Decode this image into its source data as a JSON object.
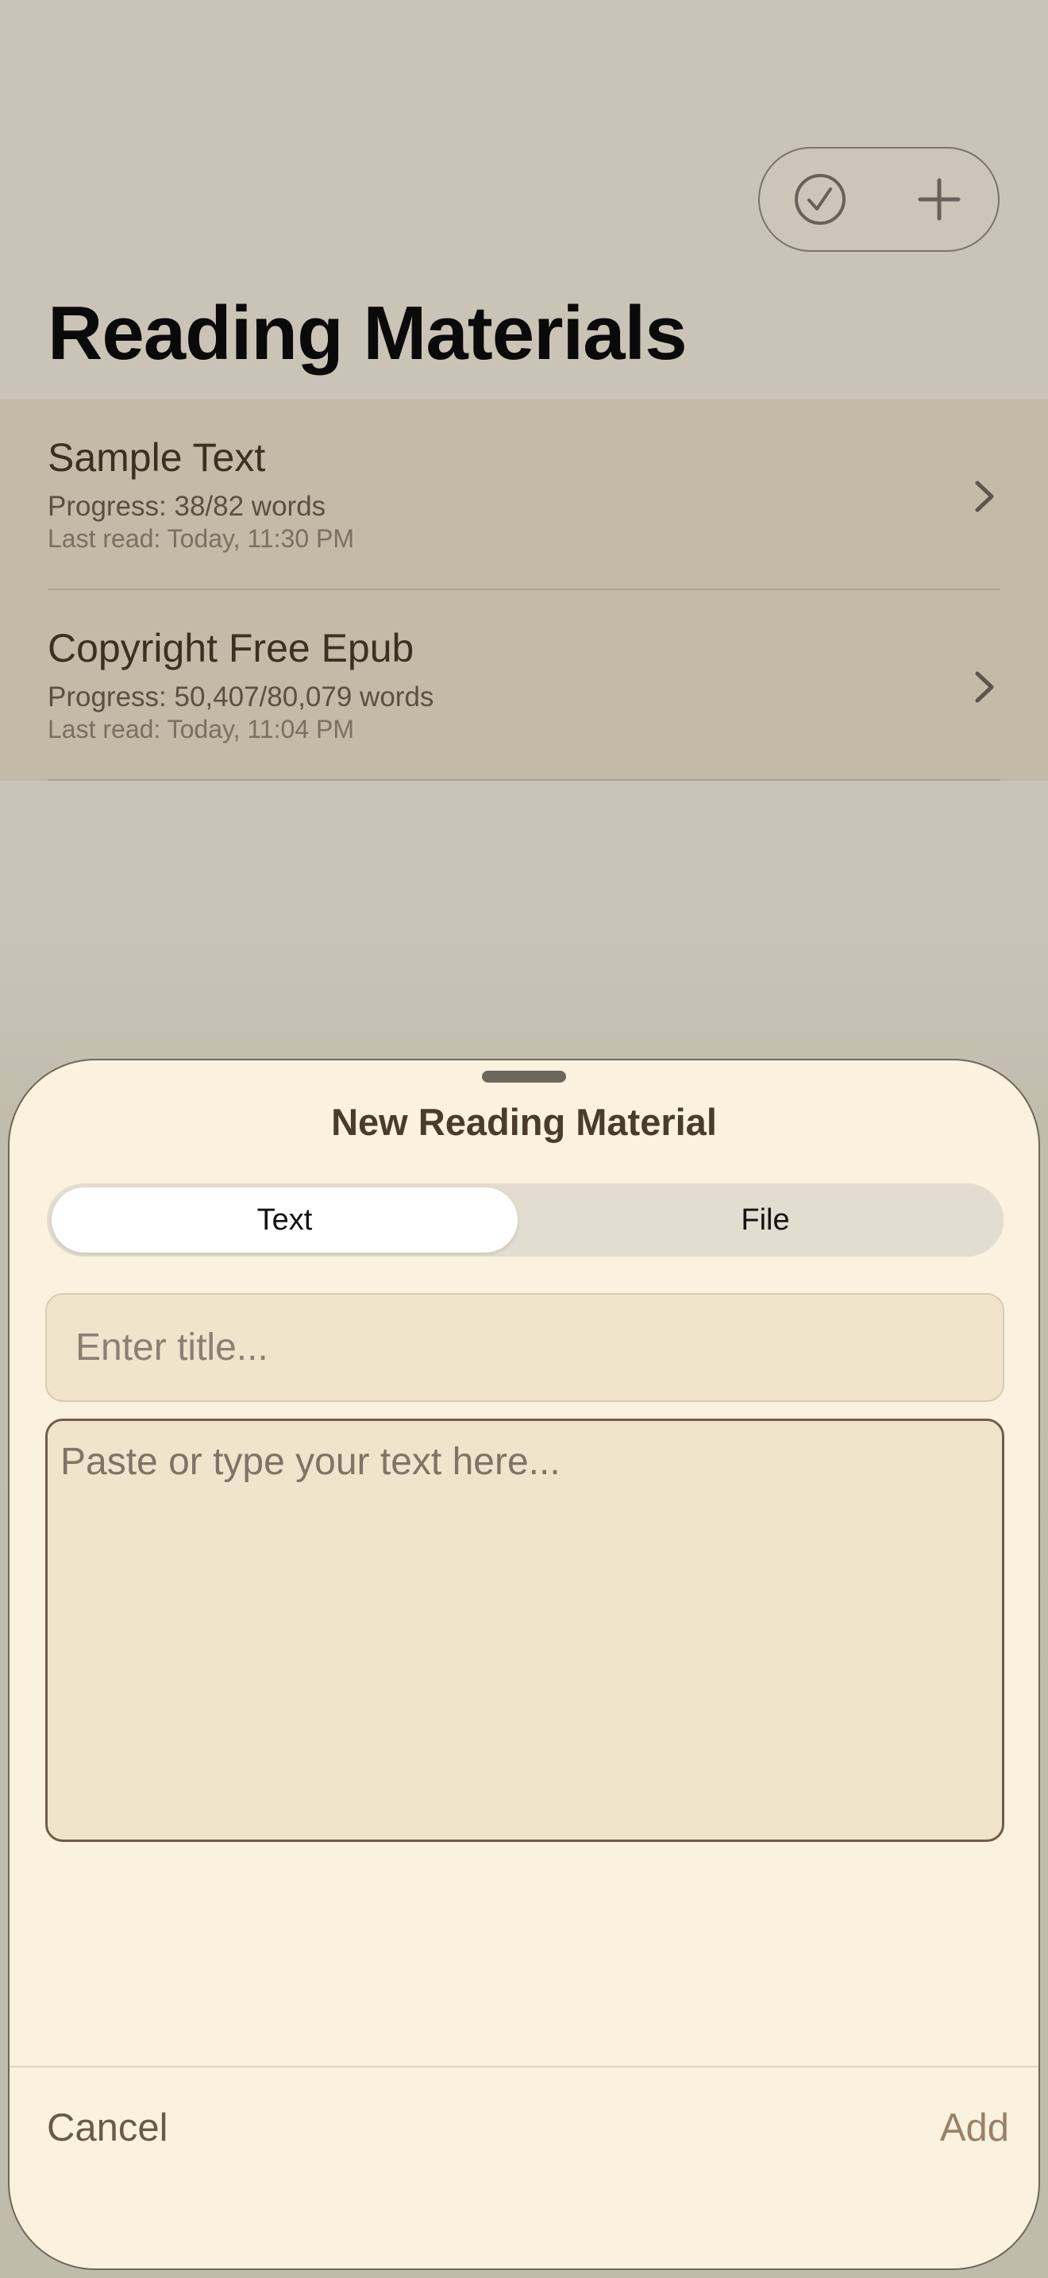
{
  "header": {
    "title": "Reading Materials",
    "select_icon": "checkmark-circle-icon",
    "add_icon": "plus-icon"
  },
  "list": {
    "items": [
      {
        "title": "Sample Text",
        "progress": "Progress: 38/82 words",
        "last_read": "Last read: Today, 11:30 PM"
      },
      {
        "title": "Copyright Free Epub",
        "progress": "Progress: 50,407/80,079 words",
        "last_read": "Last read: Today, 11:04 PM"
      }
    ]
  },
  "sheet": {
    "title": "New Reading Material",
    "segments": [
      "Text",
      "File"
    ],
    "selected_segment": "Text",
    "title_placeholder": "Enter title...",
    "text_placeholder": "Paste or type your text here...",
    "cancel_label": "Cancel",
    "add_label": "Add"
  },
  "colors": {
    "background": "#cac4b7",
    "row_background": "#c3baa7",
    "sheet_background": "#faf2df",
    "input_background": "#f0e4cd",
    "accent_brown": "#6e5d4a"
  }
}
